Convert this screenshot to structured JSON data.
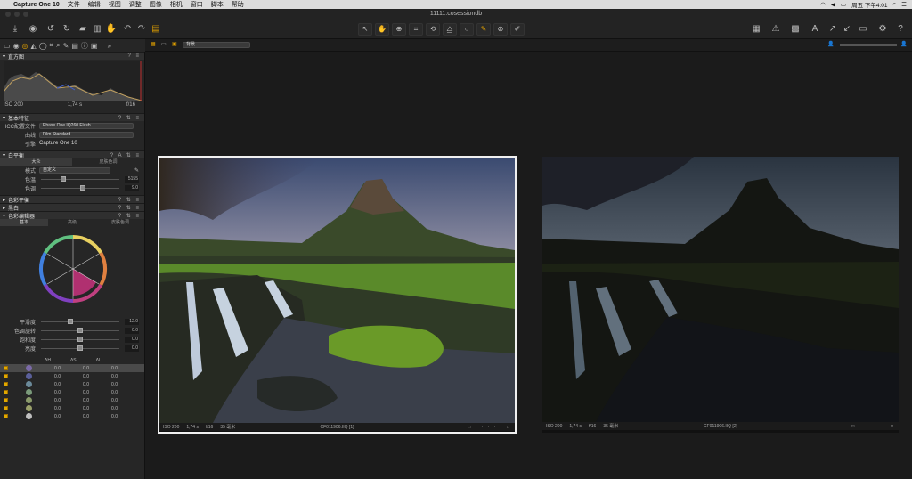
{
  "menubar": {
    "apple": "",
    "app": "Capture One 10",
    "items": [
      "文件",
      "编辑",
      "视图",
      "调整",
      "图像",
      "相机",
      "窗口",
      "脚本",
      "帮助"
    ],
    "clock": "周五 下午4:01"
  },
  "window": {
    "title": "11111.cosessiondb"
  },
  "viewer": {
    "zoom_menu": "背景"
  },
  "sidebar": {
    "histogram": {
      "title": "直方图",
      "iso": "ISO 200",
      "shutter": "1,74 s",
      "aperture": "f/16"
    },
    "basic": {
      "title": "基本特征",
      "rows": [
        {
          "label": "ICC配置文件",
          "value": "Phase One IQ260 Flash"
        },
        {
          "label": "曲线",
          "value": "Film Standard"
        },
        {
          "label": "引擎",
          "value": "Capture One 10"
        }
      ]
    },
    "wb": {
      "title": "白平衡",
      "tabs": [
        "大众",
        "皮肤色调"
      ],
      "mode_label": "模式",
      "mode_value": "自定义",
      "kelvin_label": "色温",
      "kelvin_value": "5155",
      "tint_label": "色调",
      "tint_value": "9.0"
    },
    "collapsed": [
      "色彩平衡",
      "黑白"
    ],
    "ce": {
      "title": "色彩编辑器",
      "tabs": [
        "基本",
        "高级",
        "皮肤色调"
      ],
      "sliders": [
        {
          "label": "平滑度",
          "value": "12.0"
        },
        {
          "label": "色调旋转",
          "value": "0.0"
        },
        {
          "label": "饱和度",
          "value": "0.0"
        },
        {
          "label": "亮度",
          "value": "0.0"
        }
      ],
      "headers": [
        "ΔH",
        "ΔS",
        "ΔL"
      ],
      "rows": [
        {
          "color": "#7b6aa8",
          "h": "0.0",
          "s": "0.0",
          "l": "0.0"
        },
        {
          "color": "#5a5f9a",
          "h": "0.0",
          "s": "0.0",
          "l": "0.0"
        },
        {
          "color": "#6b8a9a",
          "h": "0.0",
          "s": "0.0",
          "l": "0.0"
        },
        {
          "color": "#7a9a7a",
          "h": "0.0",
          "s": "0.0",
          "l": "0.0"
        },
        {
          "color": "#8a9a6a",
          "h": "0.0",
          "s": "0.0",
          "l": "0.0"
        },
        {
          "color": "#9aa06a",
          "h": "0.0",
          "s": "0.0",
          "l": "0.0"
        },
        {
          "color": "#bfbfbf",
          "h": "0.0",
          "s": "0.0",
          "l": "0.0"
        }
      ]
    }
  },
  "photos": [
    {
      "iso": "ISO 200",
      "shutter": "1,74 s",
      "aperture": "f/16",
      "focal": "35 毫米",
      "name": "CF011906.IIQ [1]"
    },
    {
      "iso": "ISO 200",
      "shutter": "1,74 s",
      "aperture": "f/16",
      "focal": "35 毫米",
      "name": "CF011906.IIQ [2]"
    }
  ]
}
